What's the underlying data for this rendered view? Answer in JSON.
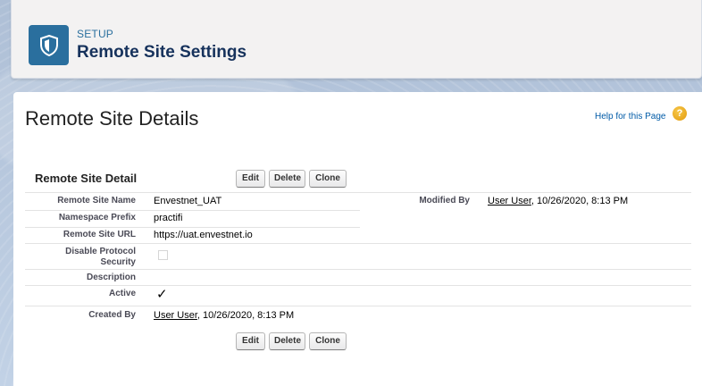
{
  "header": {
    "eyebrow": "SETUP",
    "title": "Remote Site Settings",
    "icon": "shield-icon"
  },
  "page": {
    "title": "Remote Site Details",
    "help_link": "Help for this Page",
    "help_icon": "?"
  },
  "detail": {
    "section_title": "Remote Site Detail",
    "buttons": {
      "edit": "Edit",
      "delete": "Delete",
      "clone": "Clone"
    },
    "fields": {
      "name_label": "Remote Site Name",
      "name_value": "Envestnet_UAT",
      "namespace_label": "Namespace Prefix",
      "namespace_value": "practifi",
      "url_label": "Remote Site URL",
      "url_value": "https://uat.envestnet.io",
      "disable_protocol_label_1": "Disable Protocol",
      "disable_protocol_label_2": "Security",
      "disable_protocol_value": false,
      "description_label": "Description",
      "description_value": "",
      "active_label": "Active",
      "active_value": true,
      "active_check": "✓",
      "created_by_label": "Created By",
      "created_by_user": "User User",
      "created_by_date": ", 10/26/2020, 8:13 PM",
      "modified_by_label": "Modified By",
      "modified_by_user": "User User",
      "modified_by_date": ", 10/26/2020, 8:13 PM"
    }
  },
  "colors": {
    "brand_blue": "#2a6f9e",
    "title_navy": "#16325c",
    "link_blue": "#015ba7",
    "help_orange": "#e29a0c"
  }
}
